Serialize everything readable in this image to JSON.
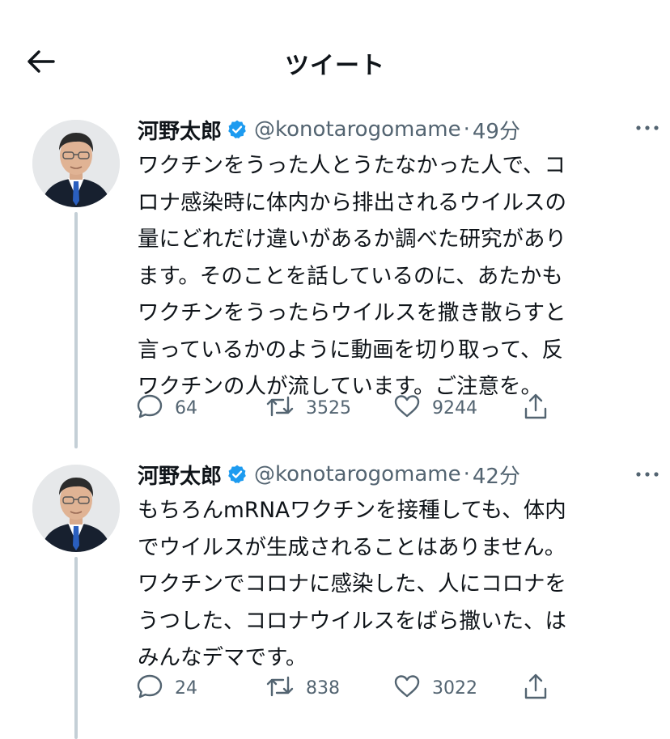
{
  "header": {
    "title": "ツイート"
  },
  "icons": {
    "back": "arrow-left-icon",
    "verified": "verified-badge-icon",
    "more": "more-horizontal-icon",
    "reply": "comment-icon",
    "retweet": "retweet-icon",
    "like": "heart-icon",
    "share": "share-icon"
  },
  "colors": {
    "verified": "#1d9bf0",
    "thread_line": "#c4cfd6",
    "muted": "#536471",
    "text": "#0f1419"
  },
  "tweets": [
    {
      "author": "河野太郎",
      "handle": "@konotarogomame",
      "separator": "·",
      "time": "49分",
      "text_lines": [
        "ワクチンをうった人とうたなかった人で、コ",
        "ロナ感染時に体内から排出されるウイルスの",
        "量にどれだけ違いがあるか調べた研究があり",
        "ます。そのことを話しているのに、あたかも",
        "ワクチンをうったらウイルスを撒き散らすと",
        "言っているかのように動画を切り取って、反",
        "ワクチンの人が流しています。ご注意を。"
      ],
      "replies": "64",
      "retweets": "3525",
      "likes": "9244"
    },
    {
      "author": "河野太郎",
      "handle": "@konotarogomame",
      "separator": "·",
      "time": "42分",
      "text_lines": [
        "もちろんmRNAワクチンを接種しても、体内",
        "でウイルスが生成されることはありません。",
        "ワクチンでコロナに感染した、人にコロナを",
        "うつした、コロナウイルスをばら撒いた、は",
        "みんなデマです。"
      ],
      "replies": "24",
      "retweets": "838",
      "likes": "3022"
    }
  ]
}
